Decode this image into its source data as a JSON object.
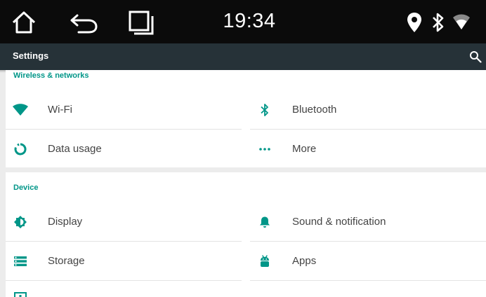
{
  "statusbar": {
    "time": "19:34",
    "nav": [
      "home-icon",
      "back-icon",
      "recents-icon"
    ],
    "indicators": [
      "location-icon",
      "bluetooth-icon",
      "wifi-icon"
    ]
  },
  "actionbar": {
    "title": "Settings",
    "search_icon": "search-icon"
  },
  "colors": {
    "accent": "#009688",
    "actionbar": "#263238",
    "statusbar": "#0b0b0b"
  },
  "sections": [
    {
      "header": "Wireless & networks",
      "items": [
        {
          "label": "Wi-Fi",
          "icon": "wifi-icon"
        },
        {
          "label": "Bluetooth",
          "icon": "bluetooth-icon"
        },
        {
          "label": "Data usage",
          "icon": "data-usage-icon"
        },
        {
          "label": "More",
          "icon": "more-icon"
        }
      ]
    },
    {
      "header": "Device",
      "items": [
        {
          "label": "Display",
          "icon": "display-icon"
        },
        {
          "label": "Sound & notification",
          "icon": "bell-icon"
        },
        {
          "label": "Storage",
          "icon": "storage-icon"
        },
        {
          "label": "Apps",
          "icon": "android-icon"
        }
      ]
    }
  ]
}
